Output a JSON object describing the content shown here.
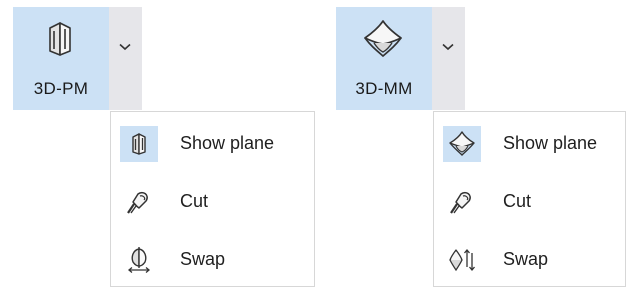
{
  "groups": [
    {
      "button_label": "3D-PM",
      "button_icon": "3d-pm-plane-icon",
      "menu_open_icon": "chevron-down-icon",
      "menu": [
        {
          "label": "Show plane",
          "icon": "show-plane-icon",
          "selected": true
        },
        {
          "label": "Cut",
          "icon": "cut-icon",
          "selected": false
        },
        {
          "label": "Swap",
          "icon": "swap-icon",
          "selected": false
        }
      ]
    },
    {
      "button_label": "3D-MM",
      "button_icon": "3d-mm-surface-icon",
      "menu_open_icon": "chevron-down-icon",
      "menu": [
        {
          "label": "Show plane",
          "icon": "show-surface-icon",
          "selected": true
        },
        {
          "label": "Cut",
          "icon": "cut-icon",
          "selected": false
        },
        {
          "label": "Swap",
          "icon": "swap-icon",
          "selected": false
        }
      ]
    }
  ],
  "colors": {
    "selected_bg": "#cce1f5",
    "split_arrow_bg": "#e6e6ea",
    "menu_border": "#d7d7d7",
    "icon_stroke": "#333333"
  }
}
